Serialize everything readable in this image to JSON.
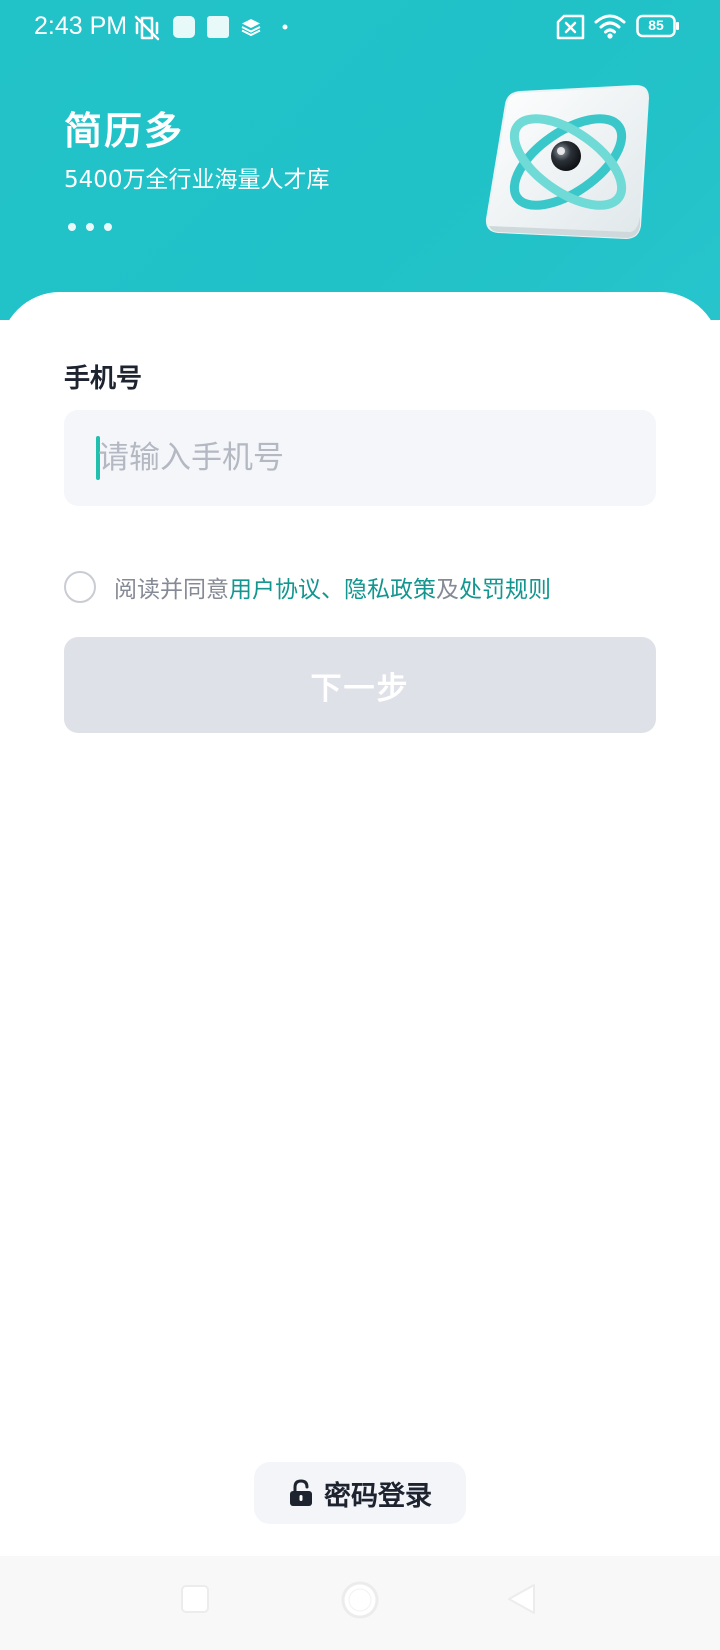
{
  "status_bar": {
    "time": "2:43 PM",
    "battery": "85",
    "icons": [
      "vibrate-off-icon",
      "app-notification-icon",
      "app-notification-icon",
      "layers-icon",
      "dot-icon",
      "no-sim-icon",
      "wifi-icon",
      "battery-icon"
    ]
  },
  "header": {
    "title": "简历多",
    "subtitle": "5400万全行业海量人才库",
    "illustration": "atom-cube-icon"
  },
  "form": {
    "phone_label": "手机号",
    "phone_placeholder": "请输入手机号",
    "phone_value": ""
  },
  "agreement": {
    "prefix": "阅读并同意",
    "user_agreement": "用户协议",
    "separator": "、",
    "privacy_policy": "隐私政策",
    "and": "及",
    "penalty_rules": "处罚规则",
    "checked": false
  },
  "next_button": "下一步",
  "password_login": "密码登录",
  "colors": {
    "header_bg": "#22c2c9",
    "link": "#12968f",
    "button_disabled": "#dfe1e8",
    "caret": "#20bfae"
  },
  "nav_bar": {
    "icons": [
      "recents-square-icon",
      "home-circle-icon",
      "back-triangle-icon"
    ]
  }
}
